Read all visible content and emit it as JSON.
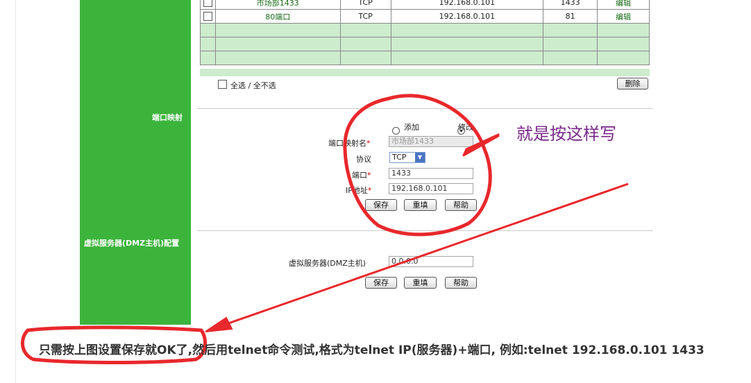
{
  "port_table": {
    "rows": [
      {
        "name": "市场部1433",
        "protocol": "TCP",
        "ip": "192.168.0.101",
        "port": "1433",
        "action": "编辑"
      },
      {
        "name": "80端口",
        "protocol": "TCP",
        "ip": "192.168.0.101",
        "port": "81",
        "action": "编辑"
      }
    ],
    "select_all_label": "全选 / 全不选",
    "delete_button": "删除"
  },
  "sidebar": {
    "port_mapping_label": "端口映射",
    "dmz_label": "虚拟服务器(DMZ主机)配置"
  },
  "port_form": {
    "radio_add": "添加",
    "radio_modify": "修改",
    "selected_mode": "修改",
    "name_label": "端口映射名",
    "name_value": "市场部1433",
    "protocol_label": "协议",
    "protocol_value": "TCP",
    "port_label": "端口",
    "port_value": "1433",
    "ip_label": "IP地址",
    "ip_value": "192.168.0.101",
    "required_mark": "*",
    "save_button": "保存",
    "reset_button": "重填",
    "help_button": "帮助"
  },
  "dmz_form": {
    "label": "虚拟服务器(DMZ主机)",
    "value": "0.0.0.0",
    "save_button": "保存",
    "reset_button": "重填",
    "help_button": "帮助"
  },
  "annotation": {
    "text": "就是按这样写",
    "color": "#7a2a8a",
    "marker_color": "#e8282c"
  },
  "caption": "只需按上图设置保存就OK了,然后用telnet命令测试,格式为telnet IP(服务器)+端口, 例如:telnet 192.168.0.101 1433",
  "colors": {
    "sidebar": "#3cb43c",
    "table_fill": "#cdeccd"
  }
}
